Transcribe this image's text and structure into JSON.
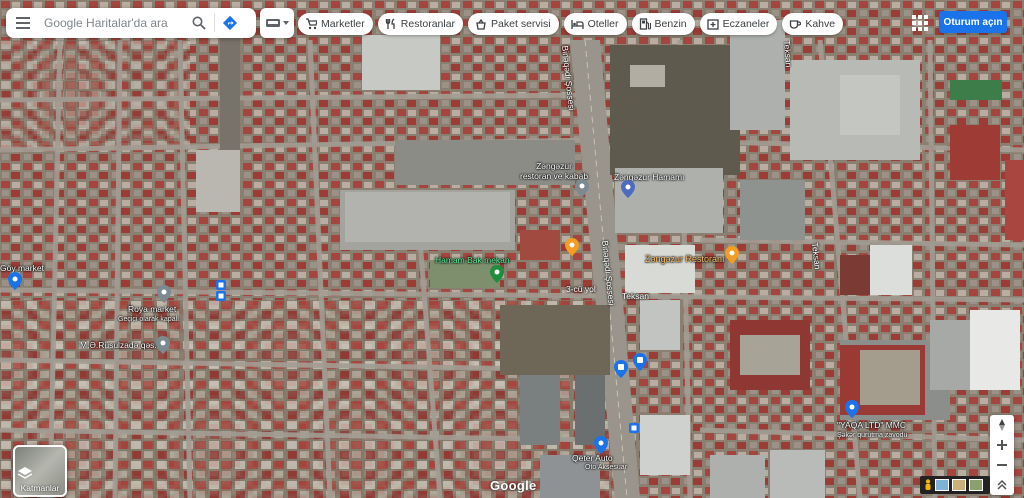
{
  "search": {
    "placeholder": "Google Haritalar'da ara"
  },
  "chips": [
    {
      "label": "Marketler",
      "icon": "cart-icon"
    },
    {
      "label": "Restoranlar",
      "icon": "fork-knife-icon"
    },
    {
      "label": "Paket servisi",
      "icon": "delivery-icon"
    },
    {
      "label": "Oteller",
      "icon": "bed-icon"
    },
    {
      "label": "Benzin",
      "icon": "gas-icon"
    },
    {
      "label": "Eczaneler",
      "icon": "pharmacy-icon"
    },
    {
      "label": "Kahve",
      "icon": "coffee-icon"
    }
  ],
  "header": {
    "signin_label": "Oturum açın"
  },
  "layers": {
    "label": "Katmanlar"
  },
  "brand": {
    "logo_text": "Google"
  },
  "places": {
    "goy_market": "Göy market",
    "roya_market": "Roya market",
    "roya_market_sub": "Geçici olarak kapalı",
    "risulzada": "M.Ə.Rüsulzadə qəs...",
    "zangezur_restoran": "Zəngəzur\nrestoran ve kabab",
    "zangezur_hamami": "Zəngəzur Hamamı",
    "zangezur_restorani": "Zəngəzur Restoranı",
    "hamam_bakkal": "Hamam Bak mekan",
    "yaqa": "\"YAQA LTD\" MMC",
    "yaqa_sub": "Şəkər qurutma zavodu",
    "qeter_auto": "Qeter Auto",
    "qeter_auto_sub": "Oto Aksesuar"
  },
  "streets": {
    "binagadi_1": "Binəqədi Şossesi",
    "binagadi_2": "Binəqədi Şossesi",
    "cu_yol": "3-cü yol",
    "teksan": "Teksan",
    "teksan_v": "Teksan",
    "teksan_top": "Teksan"
  },
  "colors": {
    "accent": "#1a73e8",
    "pin_gray": "#7b8a91",
    "pin_green": "#1e8e3e",
    "pin_orange": "#f29d24",
    "pin_blue": "#1a73e8"
  }
}
